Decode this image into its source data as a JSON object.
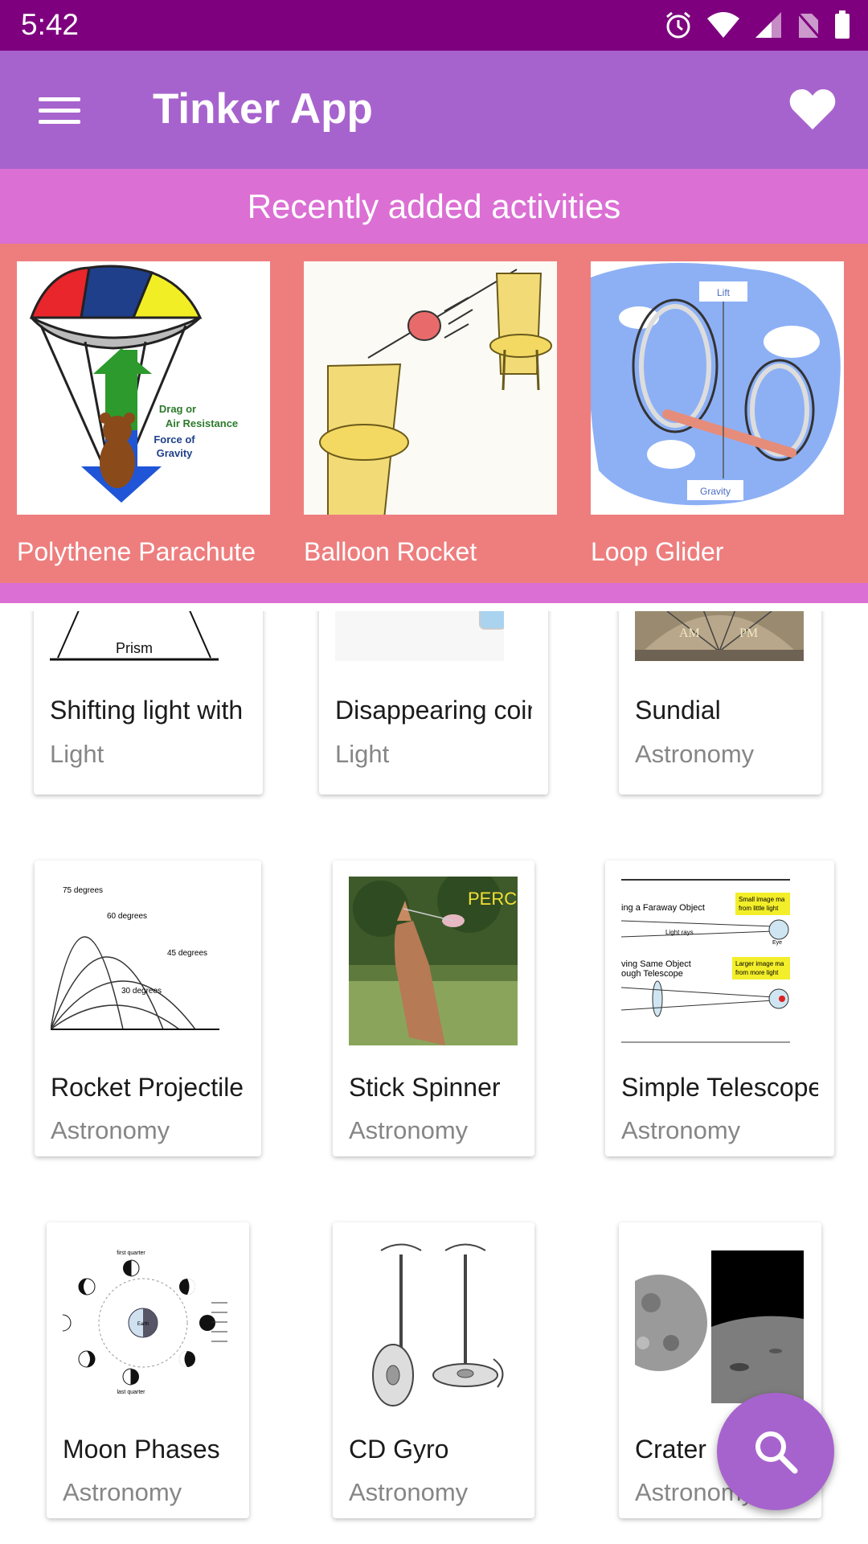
{
  "status_bar": {
    "time": "5:42"
  },
  "app_bar": {
    "title": "Tinker App"
  },
  "banner": {
    "text": "Recently added activities"
  },
  "recent": [
    {
      "label": "Polythene Parachute"
    },
    {
      "label": "Balloon Rocket"
    },
    {
      "label": "Loop Glider"
    }
  ],
  "thumb_text": {
    "parachute_1": "Drag or",
    "parachute_2": "Air Resistance",
    "parachute_3": "Force of",
    "parachute_4": "Gravity",
    "loop_top": "Lift",
    "loop_bottom": "Gravity",
    "prism": "Prism",
    "sundial_am": "AM",
    "sundial_pm": "PM",
    "deg75": "75 degrees",
    "deg60": "60 degrees",
    "deg45": "45 degrees",
    "deg30": "30 degrees",
    "spinner": "PERC",
    "tele_1": "ing a Faraway Object",
    "tele_2": "ving Same Object",
    "tele_3": "ough Telescope",
    "tele_4": "Small image ma",
    "tele_5": "from little light",
    "tele_6": "Larger image ma",
    "tele_7": "from more light",
    "tele_8": "Light rays",
    "tele_9": "Eye",
    "moon_top": "first quarter",
    "moon_bottom": "last quarter",
    "moon_earth": "Earth"
  },
  "activities": [
    {
      "name": "Shifting light with",
      "category": "Light"
    },
    {
      "name": "Disappearing coin",
      "category": "Light"
    },
    {
      "name": "Sundial",
      "category": "Astronomy"
    },
    {
      "name": "Rocket Projectile",
      "category": "Astronomy"
    },
    {
      "name": "Stick Spinner",
      "category": "Astronomy"
    },
    {
      "name": "Simple Telescope",
      "category": "Astronomy"
    },
    {
      "name": "Moon Phases",
      "category": "Astronomy"
    },
    {
      "name": "CD Gyro",
      "category": "Astronomy"
    },
    {
      "name": "Crater",
      "category": "Astronomy"
    }
  ],
  "colors": {
    "status": "#7e007e",
    "app_bar": "#a763cd",
    "banner": "#db6fd4",
    "carousel": "#ee7e7e"
  },
  "icons": [
    "menu-icon",
    "heart-icon",
    "search-icon",
    "alarm-icon",
    "wifi-icon",
    "signal-icon",
    "no-sim-icon",
    "battery-icon"
  ]
}
